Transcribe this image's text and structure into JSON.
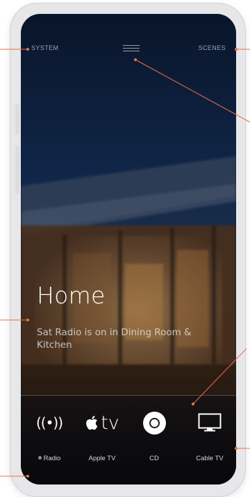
{
  "colors": {
    "frame": "#e7e7ea",
    "screen_bg": "#0f2038",
    "callout": "#e8704a",
    "text_primary": "#ffffff"
  },
  "header": {
    "system_label": "SYSTEM",
    "menu_icon": "hamburger-icon",
    "scenes_label": "SCENES"
  },
  "room": {
    "title": "Home",
    "now_playing": "Sat Radio is on in Dining Room & Kitchen"
  },
  "sources": [
    {
      "label": "Radio",
      "icon": "radio-waves-icon",
      "active": true,
      "glyph": "((•))"
    },
    {
      "label": "Apple TV",
      "icon": "apple-tv-icon",
      "active": false,
      "glyph": "tv"
    },
    {
      "label": "CD",
      "icon": "cd-icon",
      "active": false
    },
    {
      "label": "Cable TV",
      "icon": "monitor-icon",
      "active": false
    }
  ]
}
